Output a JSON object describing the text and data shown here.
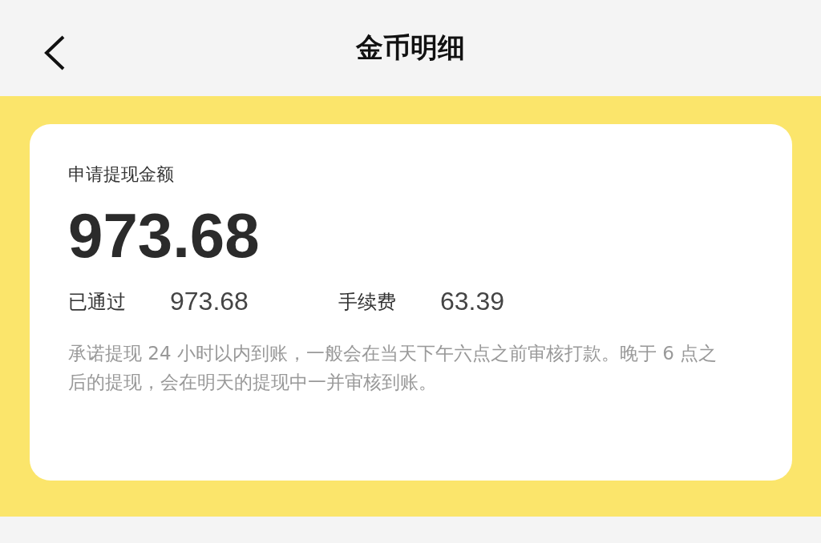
{
  "header": {
    "title": "金币明细"
  },
  "card": {
    "label": "申请提现金额",
    "amount": "973.68",
    "stats": [
      {
        "label": "已通过",
        "value": "973.68"
      },
      {
        "label": "手续费",
        "value": "63.39"
      }
    ],
    "note": "承诺提现 24 小时以内到账，一般会在当天下午六点之前审核打款。晚于 6 点之后的提现，会在明天的提现中一并审核到账。"
  }
}
